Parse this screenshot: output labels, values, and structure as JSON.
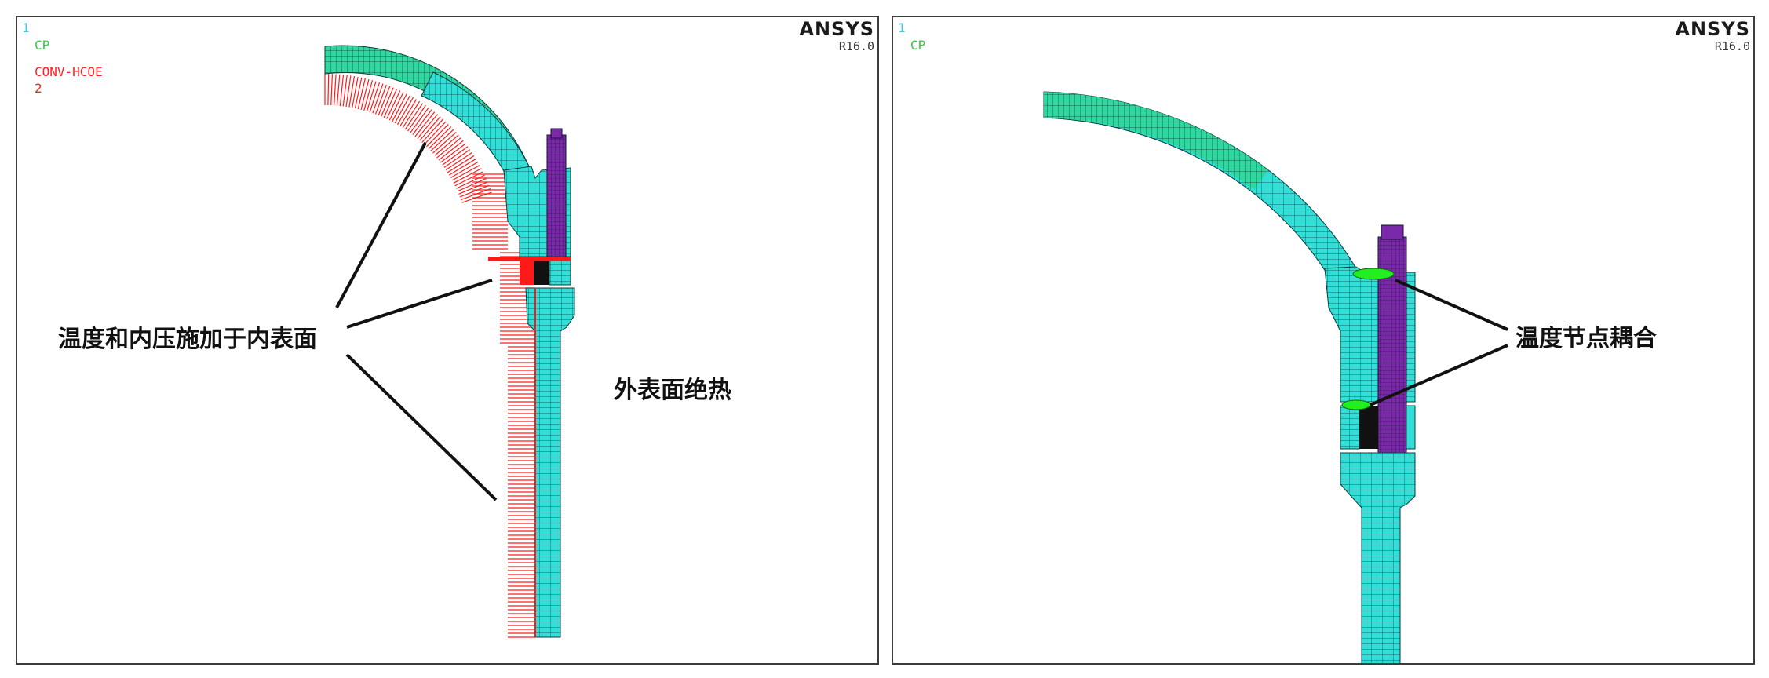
{
  "panels": [
    {
      "window_number": "1",
      "legend_cp": "CP",
      "legend_conv": "CONV-HCOE",
      "legend_conv_value": "2",
      "brand": "ANSYS",
      "version": "R16.0"
    },
    {
      "window_number": "1",
      "legend_cp": "CP",
      "brand": "ANSYS",
      "version": "R16.0"
    }
  ],
  "annotations": {
    "inner_surface_load": "温度和内压施加于内表面",
    "outer_surface_insulated": "外表面绝热",
    "temperature_coupling": "温度节点耦合"
  },
  "colors": {
    "mesh_cyan": "#30e0d8",
    "mesh_green": "#30d8a0",
    "bolt_purple": "#7a2aa8",
    "gasket_black": "#111111",
    "load_red": "#ff1a1a",
    "coupling_green": "#22ee22"
  }
}
